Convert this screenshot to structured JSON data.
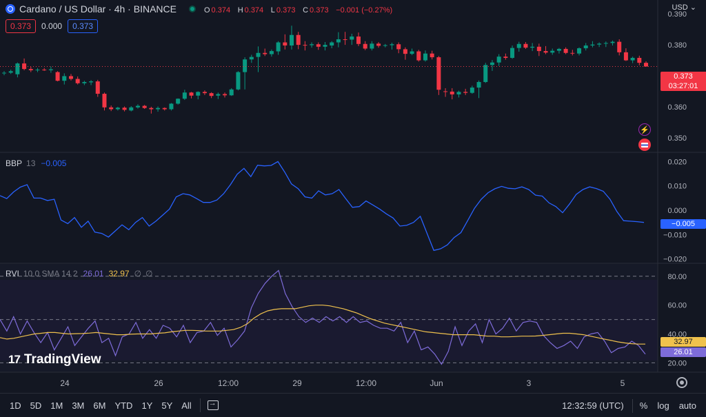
{
  "legend": {
    "symbol": "Cardano / US Dollar · 4h · BINANCE",
    "ohlc": [
      {
        "k": "O",
        "v": "0.374"
      },
      {
        "k": "H",
        "v": "0.374"
      },
      {
        "k": "L",
        "v": "0.373"
      },
      {
        "k": "C",
        "v": "0.373"
      }
    ],
    "change": "−0.001 (−0.27%)"
  },
  "quote": {
    "bid": "0.373",
    "spread": "0.000",
    "ask": "0.373"
  },
  "currency": "USD",
  "price_tag": {
    "price": "0.373",
    "countdown": "03:27:01"
  },
  "bbp": {
    "name": "BBP",
    "param": "13",
    "value": "−0.005"
  },
  "rvi": {
    "name": "RVI",
    "param": "10 0 SMA 14 2",
    "rvi_value": "26.01",
    "sma_value": "32.97",
    "na1": "∅",
    "na2": "∅"
  },
  "time_axis": [
    "24",
    "26",
    "12:00",
    "29",
    "12:00",
    "Jun",
    "3",
    "5"
  ],
  "logo": {
    "mark": "17",
    "text": "TradingView"
  },
  "bottom_bar": {
    "ranges": [
      "1D",
      "5D",
      "1M",
      "3M",
      "6M",
      "YTD",
      "1Y",
      "5Y",
      "All"
    ],
    "clock": "12:32:59 (UTC)",
    "percent": "%",
    "log": "log",
    "auto": "auto"
  },
  "colors": {
    "background": "#131722",
    "up": "#089981",
    "down": "#f23645",
    "bbp_line": "#2962ff",
    "rvi_line": "#7e6cd9",
    "sma_line": "#f0c24d"
  },
  "chart_data": [
    {
      "type": "candlestick",
      "title": "Cardano / US Dollar · 4h · BINANCE",
      "ylim": [
        0.3455,
        0.3945
      ],
      "y_ticks": [
        "0.390",
        "0.380",
        "0.370",
        "0.360",
        "0.350"
      ],
      "last_price": 0.373,
      "candles": [
        [
          0.3708,
          0.3715,
          0.3702,
          0.371
        ],
        [
          0.371,
          0.372,
          0.3706,
          0.3715
        ],
        [
          0.3705,
          0.3743,
          0.3695,
          0.374
        ],
        [
          0.374,
          0.3756,
          0.3718,
          0.3722
        ],
        [
          0.3722,
          0.3729,
          0.3712,
          0.3718
        ],
        [
          0.3718,
          0.3725,
          0.3712,
          0.372
        ],
        [
          0.372,
          0.3725,
          0.3716,
          0.3718
        ],
        [
          0.3718,
          0.373,
          0.371,
          0.3721
        ],
        [
          0.3712,
          0.3715,
          0.3682,
          0.3684
        ],
        [
          0.3684,
          0.3708,
          0.3672,
          0.3699
        ],
        [
          0.3699,
          0.3706,
          0.3685,
          0.369
        ],
        [
          0.369,
          0.3698,
          0.3672,
          0.3676
        ],
        [
          0.3676,
          0.3684,
          0.367,
          0.368
        ],
        [
          0.3679,
          0.3686,
          0.367,
          0.3682
        ],
        [
          0.3682,
          0.3687,
          0.3632,
          0.3642
        ],
        [
          0.3642,
          0.3646,
          0.3588,
          0.3598
        ],
        [
          0.3598,
          0.3604,
          0.3586,
          0.3592
        ],
        [
          0.3592,
          0.36,
          0.3588,
          0.3597
        ],
        [
          0.3597,
          0.3601,
          0.3585,
          0.359
        ],
        [
          0.3588,
          0.3602,
          0.3585,
          0.3598
        ],
        [
          0.3598,
          0.3608,
          0.3594,
          0.3603
        ],
        [
          0.3603,
          0.3606,
          0.3593,
          0.3596
        ],
        [
          0.3596,
          0.36,
          0.3578,
          0.3592
        ],
        [
          0.3592,
          0.3601,
          0.3584,
          0.3596
        ],
        [
          0.3596,
          0.3598,
          0.3588,
          0.3592
        ],
        [
          0.3592,
          0.3612,
          0.3588,
          0.361
        ],
        [
          0.361,
          0.3627,
          0.3607,
          0.3626
        ],
        [
          0.3626,
          0.3655,
          0.3622,
          0.3646
        ],
        [
          0.3646,
          0.3648,
          0.3627,
          0.3636
        ],
        [
          0.3636,
          0.365,
          0.3624,
          0.3648
        ],
        [
          0.3648,
          0.3653,
          0.3638,
          0.3644
        ],
        [
          0.3644,
          0.3647,
          0.3628,
          0.3635
        ],
        [
          0.3636,
          0.3646,
          0.3625,
          0.3641
        ],
        [
          0.3641,
          0.3646,
          0.363,
          0.3637
        ],
        [
          0.3637,
          0.366,
          0.3635,
          0.3656
        ],
        [
          0.3656,
          0.3715,
          0.3653,
          0.3712
        ],
        [
          0.3712,
          0.376,
          0.3656,
          0.3753
        ],
        [
          0.3753,
          0.3768,
          0.3742,
          0.3761
        ],
        [
          0.3761,
          0.3795,
          0.3712,
          0.3774
        ],
        [
          0.3774,
          0.3788,
          0.3764,
          0.377
        ],
        [
          0.377,
          0.3785,
          0.3762,
          0.378
        ],
        [
          0.3779,
          0.3812,
          0.3768,
          0.3808
        ],
        [
          0.3808,
          0.3834,
          0.3785,
          0.3798
        ],
        [
          0.3798,
          0.3862,
          0.3785,
          0.3832
        ],
        [
          0.3832,
          0.3842,
          0.3786,
          0.38
        ],
        [
          0.38,
          0.3812,
          0.3782,
          0.3799
        ],
        [
          0.3799,
          0.3808,
          0.3791,
          0.3802
        ],
        [
          0.3802,
          0.3808,
          0.3784,
          0.3794
        ],
        [
          0.3794,
          0.3809,
          0.3782,
          0.38
        ],
        [
          0.3798,
          0.3812,
          0.3789,
          0.3808
        ],
        [
          0.3808,
          0.3841,
          0.3792,
          0.3818
        ],
        [
          0.3818,
          0.3842,
          0.38,
          0.3817
        ],
        [
          0.3817,
          0.3836,
          0.38,
          0.3827
        ],
        [
          0.3827,
          0.384,
          0.3796,
          0.3803
        ],
        [
          0.3803,
          0.3812,
          0.3783,
          0.3788
        ],
        [
          0.3788,
          0.3812,
          0.3782,
          0.3804
        ],
        [
          0.3804,
          0.3809,
          0.3791,
          0.3797
        ],
        [
          0.3797,
          0.3803,
          0.3792,
          0.3799
        ],
        [
          0.3799,
          0.3807,
          0.3785,
          0.3802
        ],
        [
          0.3802,
          0.3808,
          0.3773,
          0.3786
        ],
        [
          0.3786,
          0.3792,
          0.3752,
          0.3771
        ],
        [
          0.3771,
          0.3788,
          0.3767,
          0.3779
        ],
        [
          0.3779,
          0.3784,
          0.3746,
          0.375
        ],
        [
          0.375,
          0.3782,
          0.3746,
          0.3772
        ],
        [
          0.3772,
          0.3781,
          0.3753,
          0.376
        ],
        [
          0.376,
          0.3764,
          0.3638,
          0.3655
        ],
        [
          0.365,
          0.366,
          0.3632,
          0.3649
        ],
        [
          0.3649,
          0.366,
          0.3624,
          0.364
        ],
        [
          0.364,
          0.3652,
          0.363,
          0.3648
        ],
        [
          0.3648,
          0.3658,
          0.3638,
          0.3645
        ],
        [
          0.3645,
          0.3668,
          0.3642,
          0.3662
        ],
        [
          0.3662,
          0.3685,
          0.3628,
          0.368
        ],
        [
          0.368,
          0.3742,
          0.3677,
          0.3735
        ],
        [
          0.3735,
          0.3751,
          0.3716,
          0.3743
        ],
        [
          0.3743,
          0.377,
          0.3732,
          0.3762
        ],
        [
          0.3762,
          0.3772,
          0.3752,
          0.3758
        ],
        [
          0.3758,
          0.3798,
          0.3755,
          0.379
        ],
        [
          0.379,
          0.381,
          0.3778,
          0.3803
        ],
        [
          0.3803,
          0.3809,
          0.3787,
          0.3791
        ],
        [
          0.3791,
          0.3806,
          0.378,
          0.3794
        ],
        [
          0.3794,
          0.3804,
          0.3764,
          0.378
        ],
        [
          0.378,
          0.3796,
          0.377,
          0.3775
        ],
        [
          0.3775,
          0.3788,
          0.3768,
          0.3781
        ],
        [
          0.3781,
          0.379,
          0.3772,
          0.3787
        ],
        [
          0.3787,
          0.3792,
          0.377,
          0.3774
        ],
        [
          0.3774,
          0.3784,
          0.3766,
          0.3772
        ],
        [
          0.3772,
          0.3792,
          0.3766,
          0.3789
        ],
        [
          0.3789,
          0.3806,
          0.3782,
          0.3798
        ],
        [
          0.3798,
          0.3812,
          0.3792,
          0.3801
        ],
        [
          0.3801,
          0.3808,
          0.3793,
          0.3804
        ],
        [
          0.3804,
          0.3811,
          0.3793,
          0.3806
        ],
        [
          0.3806,
          0.3814,
          0.3798,
          0.381
        ],
        [
          0.381,
          0.3818,
          0.3766,
          0.3776
        ],
        [
          0.3776,
          0.3789,
          0.3748,
          0.375
        ],
        [
          0.375,
          0.3762,
          0.3741,
          0.3758
        ],
        [
          0.3758,
          0.3765,
          0.3734,
          0.3742
        ],
        [
          0.3742,
          0.3747,
          0.373,
          0.373
        ]
      ]
    },
    {
      "type": "line",
      "title": "BBP 13",
      "ylim": [
        -0.0215,
        0.0235
      ],
      "y_ticks": [
        "0.020",
        "0.010",
        "0.000",
        "−0.010",
        "−0.020"
      ],
      "values": [
        0.006,
        0.0048,
        0.0075,
        0.0095,
        0.0105,
        0.005,
        0.005,
        0.004,
        0.0045,
        -0.004,
        -0.0055,
        -0.003,
        -0.007,
        -0.0045,
        -0.009,
        -0.0095,
        -0.011,
        -0.0085,
        -0.006,
        -0.008,
        -0.005,
        -0.003,
        -0.0065,
        -0.0045,
        -0.002,
        0.0005,
        0.0055,
        0.0068,
        0.0063,
        0.0048,
        0.0032,
        0.0032,
        0.0042,
        0.0068,
        0.0105,
        0.0148,
        0.0172,
        0.0138,
        0.0185,
        0.0182,
        0.0184,
        0.02,
        0.0157,
        0.0108,
        0.0088,
        0.0055,
        0.005,
        0.008,
        0.0063,
        0.0068,
        0.0085,
        0.0048,
        0.0012,
        0.0015,
        0.0038,
        0.0022,
        0.0005,
        -0.0015,
        -0.0032,
        -0.0065,
        -0.0062,
        -0.005,
        -0.0025,
        -0.0095,
        -0.0165,
        -0.0158,
        -0.0142,
        -0.0112,
        -0.0092,
        -0.0042,
        0.0008,
        0.0045,
        0.0072,
        0.0088,
        0.0098,
        0.009,
        0.0088,
        0.0096,
        0.0085,
        0.0062,
        0.0058,
        0.003,
        0.0015,
        -0.001,
        0.0025,
        0.0065,
        0.0085,
        0.0096,
        0.0089,
        0.0078,
        0.0045,
        -0.0005,
        -0.0043,
        -0.0045,
        -0.0047,
        -0.005
      ],
      "last_value": -0.005
    },
    {
      "type": "line",
      "title": "RVI 10 0 SMA 14 2",
      "ylim": [
        13.5,
        88.5
      ],
      "y_ticks": [
        "80.00",
        "60.00",
        "40.00",
        "20.00"
      ],
      "bands": [
        80,
        50,
        20
      ],
      "series": [
        {
          "name": "RVI",
          "values": [
            50,
            42,
            52,
            40,
            49,
            41,
            34,
            41,
            29,
            37,
            45,
            32,
            38,
            44,
            49,
            34,
            37,
            25,
            38,
            40,
            48,
            37,
            43,
            37,
            46,
            44,
            38,
            46,
            34,
            41,
            42,
            48,
            39,
            44,
            31,
            36,
            42,
            58,
            68,
            75,
            80,
            84,
            68,
            59,
            52,
            48,
            51,
            48,
            52,
            49,
            52,
            48,
            52,
            48,
            49,
            46,
            44,
            44,
            42,
            48,
            34,
            42,
            29,
            31,
            26,
            19,
            28,
            45,
            32,
            42,
            47,
            34,
            50,
            40,
            44,
            51,
            42,
            48,
            49,
            48,
            39,
            34,
            30,
            32,
            35,
            30,
            38,
            40,
            41,
            35,
            27,
            30,
            31,
            35,
            32,
            26
          ]
        },
        {
          "name": "SMA",
          "values": [
            37.5,
            36.5,
            37,
            38,
            39,
            40,
            40.5,
            41,
            41,
            40.5,
            40,
            40.2,
            40.3,
            40.6,
            41,
            40.5,
            40,
            39.5,
            39.5,
            39.8,
            40,
            40,
            40,
            40.5,
            40.8,
            41.5,
            42,
            42.5,
            42.5,
            42.3,
            42,
            42,
            42,
            42.5,
            43,
            44.5,
            47,
            51,
            54,
            56,
            57,
            57.5,
            57.5,
            57.5,
            58.5,
            59.5,
            60,
            60,
            59.5,
            58.5,
            57.5,
            56,
            54.5,
            52.5,
            50.5,
            49,
            47.5,
            46.5,
            45.5,
            44.5,
            43.5,
            42.5,
            41.5,
            41,
            40.5,
            40,
            39.5,
            39.5,
            39.5,
            39.5,
            39,
            38.5,
            38.5,
            38,
            38,
            38.2,
            38.5,
            38.5,
            38.6,
            39,
            39.5,
            40,
            40.5,
            40.5,
            40,
            39.5,
            38.5,
            37.5,
            36.5,
            35.5,
            34.5,
            33.8,
            33.3,
            33,
            32.97
          ]
        }
      ],
      "last_values": {
        "rvi": 26.01,
        "sma": 32.97
      }
    }
  ]
}
